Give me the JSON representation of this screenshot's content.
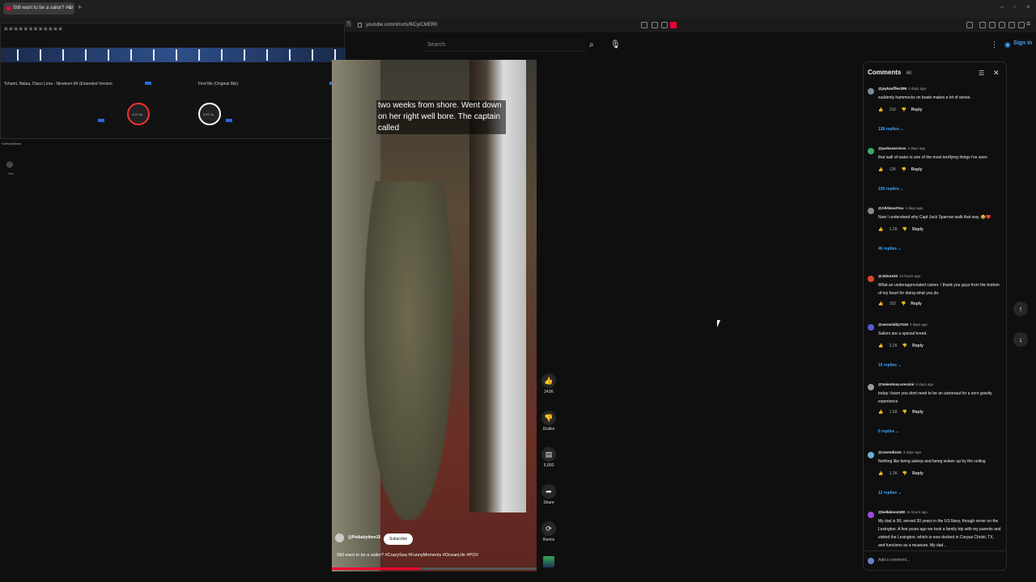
{
  "browser": {
    "tab_title": "Still want to be a sailor? #Cr",
    "url": "youtube.com/shorts/9iCyiCMER0"
  },
  "dj_app": {
    "deck_a_track": "Tchami, Malaa, Diaco Lima - Nineteen 84 (Extended Version",
    "deck_b_track": "Find Me (Original Mix)",
    "deck_a_time": "1:27.4s",
    "deck_b_time": "0:57.1s"
  },
  "youtube": {
    "search_placeholder": "Search",
    "signin_label": "Sign in",
    "sidebar_subscriptions": "Subscriptions",
    "sidebar_you": "You"
  },
  "video": {
    "caption": "two weeks from shore. Went down on her right well bore. The captain called",
    "channel": "@Petbabytime15",
    "subscribe_label": "Subscribe",
    "title": "Still want to be a sailor? #CrazySea #FunnyMoments #OceanLife #POV",
    "progress": 0.43
  },
  "actions": {
    "like_count": "243K",
    "dislike_label": "Dislike",
    "comments_count": "6,000",
    "share_label": "Share",
    "remix_label": "Remix"
  },
  "comments_panel": {
    "title": "Comments",
    "count": "6K",
    "add_placeholder": "Add a comment...",
    "items": [
      {
        "user": "@jaykauffles386",
        "time": "4 days ago",
        "text": "suddenly hammocks on boats makes a lot of sense.",
        "likes": "21K",
        "reply": "Reply",
        "replies": "138 replies",
        "color": "#7a8aa0"
      },
      {
        "user": "@parksservices",
        "time": "4 days ago",
        "text": "that wall of water is one of the most terrifying things i've seen",
        "likes": "12K",
        "reply": "Reply",
        "replies": "150 replies",
        "color": "#3aa86a"
      },
      {
        "user": "@AllAboutYou",
        "time": "4 days ago",
        "text": "Now I understand why Capt Jack Sparrow walk that way. 😂❤️",
        "likes": "1.2K",
        "reply": "Reply",
        "replies": "46 replies",
        "color": "#8a8a8a"
      },
      {
        "user": "@Jshore22",
        "time": "14 hours ago",
        "text": "What an underappreciated career. I thank you guys from the bottom of my heart for doing what you do.",
        "likes": "192",
        "reply": "Reply",
        "replies": "",
        "color": "#d8492a"
      },
      {
        "user": "@seremiddy7219",
        "time": "4 days ago",
        "text": "Sailors are a special  breed.",
        "likes": "2.2K",
        "reply": "Reply",
        "replies": "16 replies",
        "color": "#5a5ad8"
      },
      {
        "user": "@ValentinoLorenzini",
        "time": "5 days ago",
        "text": "today i learn you dont need to be an astronaut for a zero gravity experience",
        "likes": "1.5K",
        "reply": "Reply",
        "replies": "6 replies",
        "color": "#9a9a9a"
      },
      {
        "user": "@ravendizzer",
        "time": "2 days ago",
        "text": "Nothing like being asleep and being woken up by the ceiling",
        "likes": "1.3K",
        "reply": "Reply",
        "replies": "12 replies",
        "color": "#6ab0d8"
      },
      {
        "user": "@bellaboo2438",
        "time": "11 hours ago",
        "text": "My dad is 90, served 20 years in the US Navy, though never on the Lexington. A few years ago we took a family trip with my parents and visited the Lexington, which is now docked in Corpus Christi, TX, and functions as a museum. My dad ..",
        "likes": "",
        "reply": "",
        "replies": "",
        "color": "#a04ad8"
      }
    ]
  }
}
